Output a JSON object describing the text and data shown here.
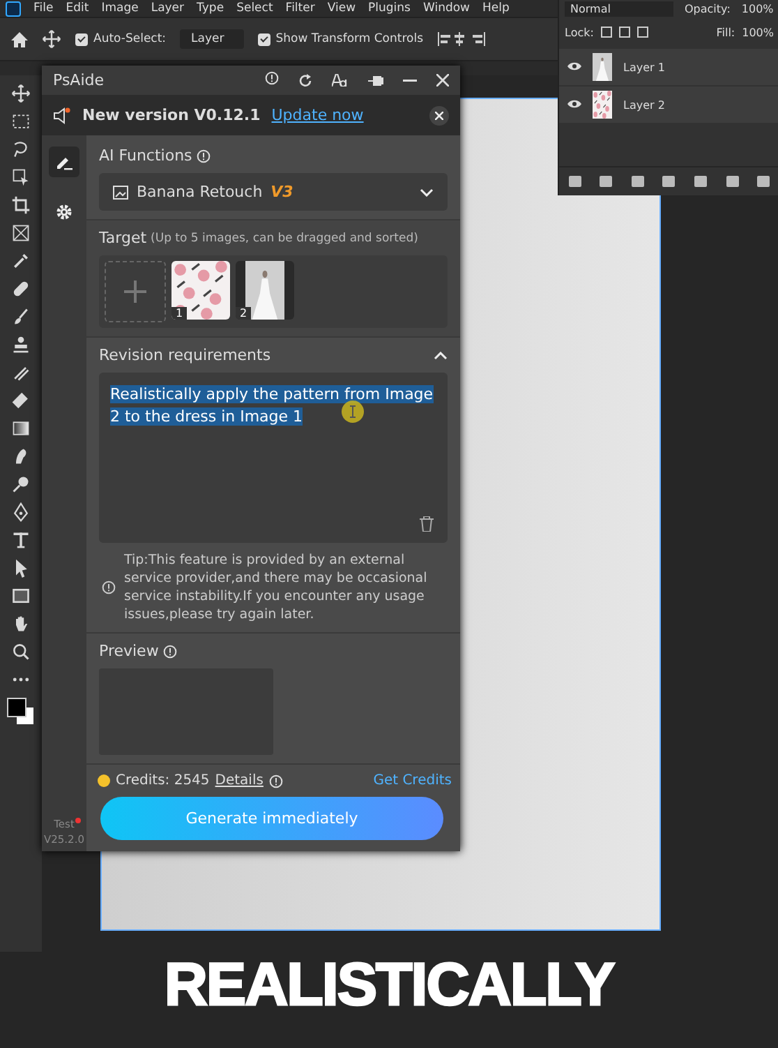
{
  "menu_bar": {
    "items": [
      "File",
      "Edit",
      "Image",
      "Layer",
      "Type",
      "Select",
      "Filter",
      "View",
      "Plugins",
      "Window",
      "Help"
    ]
  },
  "options_bar": {
    "auto_select": {
      "label": "Auto-Select:",
      "checked": true
    },
    "target": {
      "value": "Layer"
    },
    "show_transform": {
      "label": "Show Transform Controls",
      "checked": true
    }
  },
  "layers_panel": {
    "blend_mode": "Normal",
    "opacity_label": "Opacity:",
    "opacity": "100%",
    "lock_label": "Lock:",
    "fill_label": "Fill:",
    "fill": "100%",
    "layers": [
      {
        "name": "Layer 1",
        "visible": true,
        "kind": "photo"
      },
      {
        "name": "Layer 2",
        "visible": true,
        "kind": "pattern"
      }
    ]
  },
  "plugin": {
    "title": "PsAide",
    "banner": {
      "text": "New version V0.12.1",
      "link": "Update now"
    },
    "side_tabs": [
      {
        "kind": "edit",
        "selected": true
      },
      {
        "kind": "settings",
        "selected": false
      }
    ],
    "ai_functions": {
      "label": "AI Functions",
      "value": "Banana Retouch",
      "badge": "V3"
    },
    "target": {
      "label": "Target",
      "hint": "(Up to 5 images, can be dragged and sorted)",
      "images": [
        {
          "kind": "pattern",
          "index": "1"
        },
        {
          "kind": "photo",
          "index": "2"
        }
      ]
    },
    "revision": {
      "label": "Revision requirements",
      "expanded": true,
      "value": "Realistically apply the pattern from Image 2 to the dress in Image 1",
      "selected": true,
      "tip": "Tip:This feature is provided by an external service provider,and there may be occasional service instability.If you encounter any usage issues,please try again later."
    },
    "preview": {
      "label": "Preview"
    },
    "credits": {
      "label": "Credits: 2545",
      "details": "Details",
      "get": "Get Credits"
    },
    "generate_button": "Generate immediately",
    "env": {
      "label": "Test",
      "version": "V25.2.0"
    }
  },
  "caption": "REALISTICALLY"
}
